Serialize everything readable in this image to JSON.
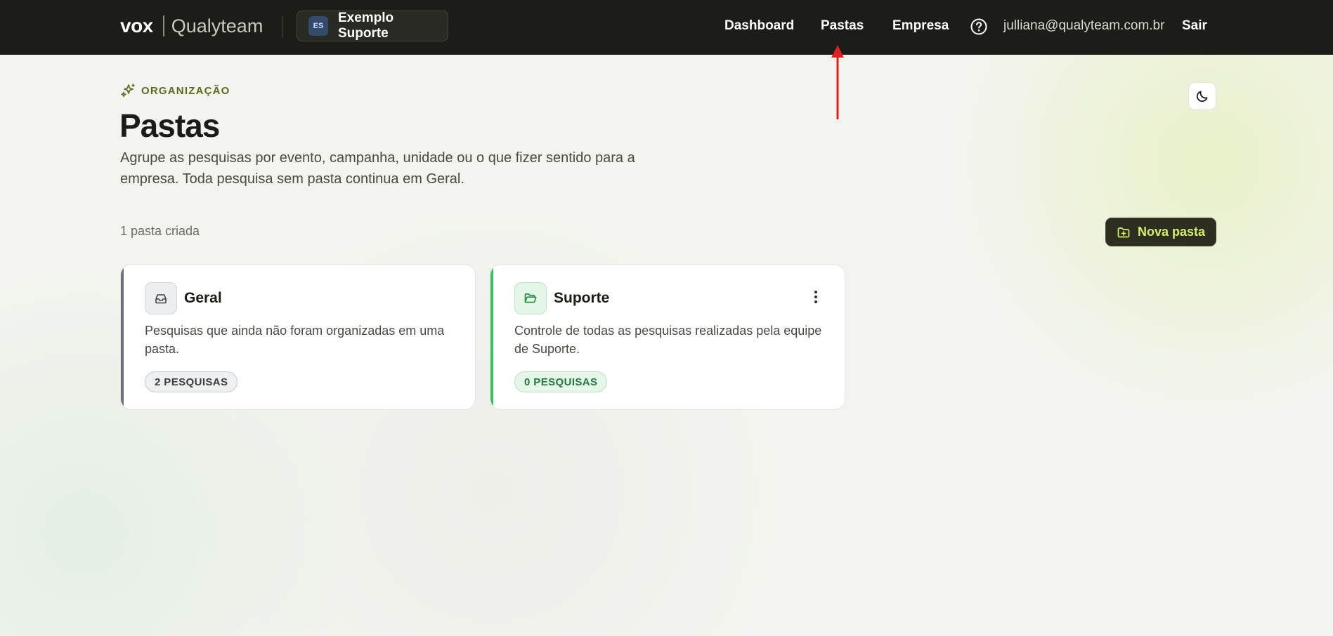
{
  "header": {
    "brand_primary": "vox",
    "brand_secondary": "Qualyteam",
    "org": {
      "initials": "ES",
      "name": "Exemplo Suporte"
    },
    "nav": [
      {
        "label": "Dashboard"
      },
      {
        "label": "Pastas"
      },
      {
        "label": "Empresa"
      }
    ],
    "help_icon": "question-circle-icon",
    "user_email": "julliana@qualyteam.com.br",
    "logout_label": "Sair"
  },
  "page": {
    "eyebrow": "ORGANIZAÇÃO",
    "title": "Pastas",
    "description": "Agrupe as pesquisas por evento, campanha, unidade ou o que fizer sentido para a empresa. Toda pesquisa sem pasta continua em Geral.",
    "theme_toggle_icon": "moon-icon",
    "count_text": "1 pasta criada",
    "new_folder_label": "Nova pasta"
  },
  "folders": [
    {
      "title": "Geral",
      "description": "Pesquisas que ainda não foram organizadas em uma pasta.",
      "badge": "2 PESQUISAS",
      "icon": "inbox-icon",
      "accent": "#6b6f75"
    },
    {
      "title": "Suporte",
      "description": "Controle de todas as pesquisas realizadas pela equipe de Suporte.",
      "badge": "0 PESQUISAS",
      "icon": "folder-open-icon",
      "accent": "#34c25a"
    }
  ],
  "colors": {
    "topbar": "#1c1c18",
    "accent_lime": "#d6f06a",
    "eyebrow_olive": "#5c6b1e",
    "annotation_red": "#e02020"
  }
}
